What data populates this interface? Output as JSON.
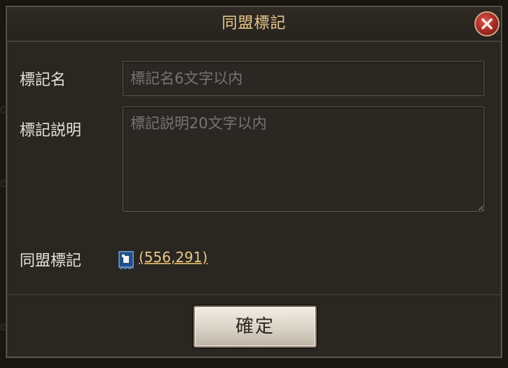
{
  "dialog": {
    "title": "同盟標記",
    "close_icon": "close-x-icon"
  },
  "form": {
    "name_label": "標記名",
    "name_placeholder": "標記名6文字以内",
    "desc_label": "標記説明",
    "desc_placeholder": "標記説明20文字以内",
    "alliance_label": "同盟標記",
    "alliance_flag_icon": "alliance-flag-icon",
    "coordinates": "(556,291)"
  },
  "footer": {
    "confirm_label": "確定"
  },
  "colors": {
    "title": "#e8c98b",
    "link": "#e8c98b",
    "close": "#a32a22"
  }
}
